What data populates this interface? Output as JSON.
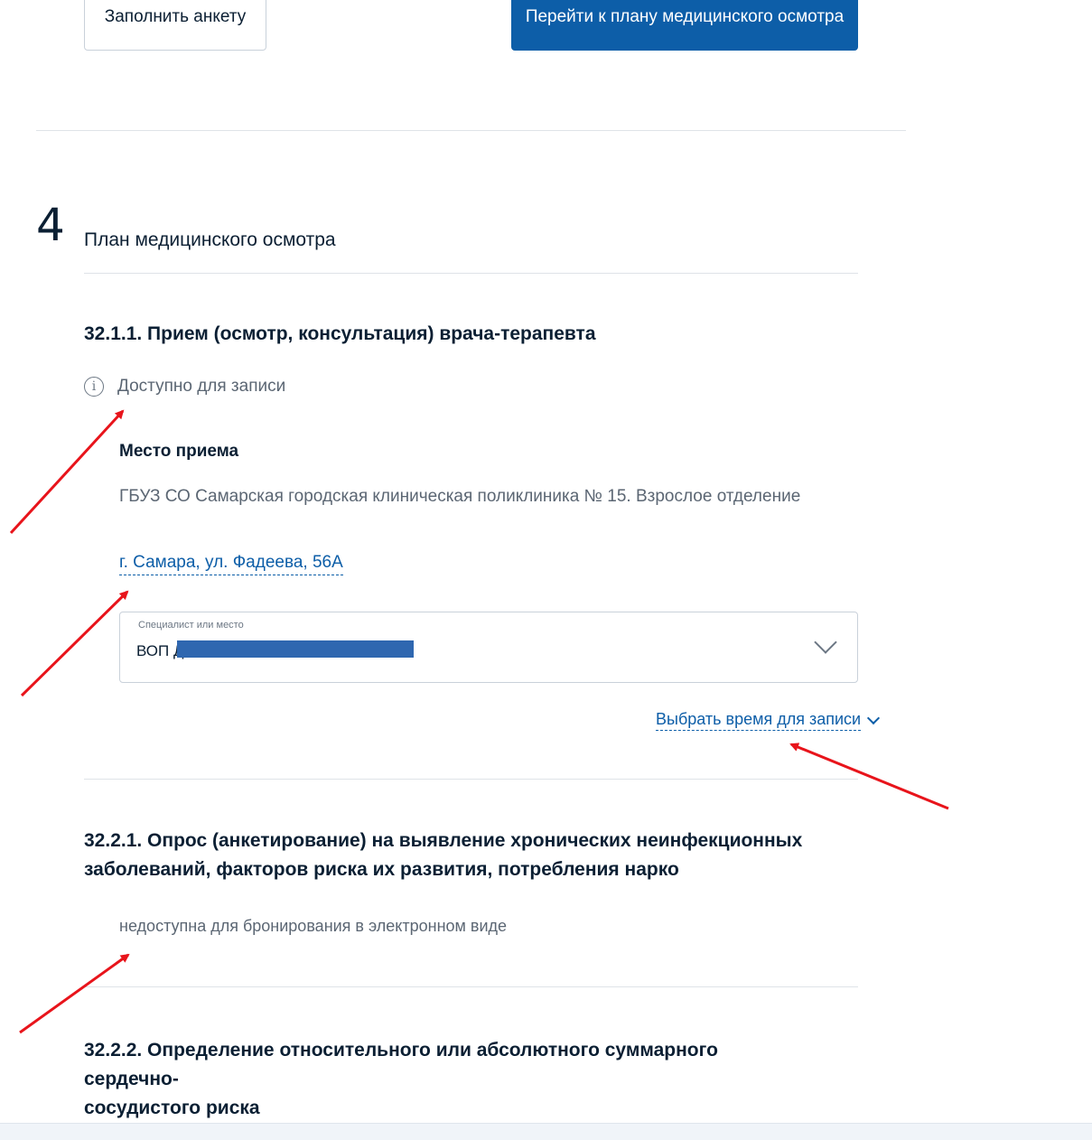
{
  "top_buttons": {
    "fill_form": "Заполнить анкету",
    "go_to_plan": "Перейти к плану медицинского осмотра"
  },
  "step": {
    "number": "4",
    "title": "План медицинского осмотра"
  },
  "services": [
    {
      "title": "32.1.1. Прием (осмотр, консультация) врача-терапевта",
      "status": "Доступно для записи",
      "place_label": "Место приема",
      "place_name": "ГБУЗ СО Самарская городская клиническая поликлиника № 15. Взрослое отделение",
      "address": "г. Самара, ул. Фадеева, 56А",
      "specialist_select": {
        "label": "Специалист или место",
        "value": "ВОП Д"
      },
      "choose_time": "Выбрать время для записи"
    },
    {
      "title_line1": "32.2.1. Опрос (анкетирование) на выявление хронических неинфекционных",
      "title_line2": "заболеваний, факторов риска их развития, потребления нарко",
      "status": "недоступна для бронирования в электронном виде"
    },
    {
      "title_line1": "32.2.2. Определение относительного или абсолютного суммарного сердечно-",
      "title_line2": "сосудистого риска"
    }
  ],
  "colors": {
    "primary": "#0d5ea8",
    "text": "#0b1f33",
    "muted": "#5b6673",
    "annotation_arrow": "#e8141b",
    "redaction": "#2f67b0"
  }
}
